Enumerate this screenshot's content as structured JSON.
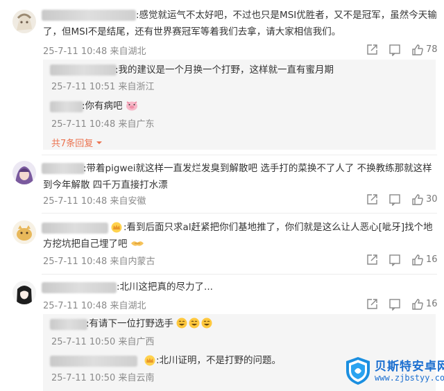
{
  "comments": [
    {
      "text_line1": ":感觉就运气不太好吧，不过也只是MSI优胜者，又不是冠军，虽然今天输",
      "text_line2": "了，但MSI不是结尾，还有世界赛冠军等着我们去拿，请大家相信我们。",
      "meta": "25-7-11 10:48 来自湖北",
      "likes": "78",
      "replies": [
        {
          "text": ":我的建议是一个月换一个打野，这样就一直有蜜月期",
          "meta": "25-7-11 10:51 来自浙江"
        },
        {
          "text": ":你有病吧",
          "meta": "25-7-11 10:48 来自广东"
        }
      ],
      "more_replies": "共7条回复"
    },
    {
      "text_line1": ":带着pigwei就这样一直发烂发臭到解散吧  选手打的菜换不了人了  不换教练那就这样",
      "text_line2": "到今年解散  四千万直接打水漂",
      "meta": "25-7-11 10:48 来自安徽",
      "likes": "30"
    },
    {
      "text_line1": ":看到后面只求al赶紧把你们基地推了，你们就是这么让人恶心[呲牙]找个地",
      "text_line2": "方挖坑把自己埋了吧",
      "meta": "25-7-11 10:48 来自内蒙古",
      "likes": "16"
    },
    {
      "text_line1": ":北川这把真的尽力了...",
      "meta": "25-7-11 10:48 来自湖北",
      "likes": "16",
      "replies": [
        {
          "text": ":有请下一位打野选手",
          "meta": "25-7-11 10:50 来自广西"
        },
        {
          "text": ":北川证明，不是打野的问题。",
          "meta": "25-7-11 10:50 来自云南"
        }
      ]
    }
  ],
  "watermark": {
    "title": "贝斯特安卓网",
    "url": "www.zjbstyy.com"
  },
  "colors": {
    "accent": "#eb7350",
    "meta": "#8a8a8a",
    "reply_bg": "#f5f5f5"
  },
  "icons": [
    "share-icon",
    "comment-icon",
    "like-icon",
    "chevron-down-icon",
    "shield-logo-icon"
  ]
}
